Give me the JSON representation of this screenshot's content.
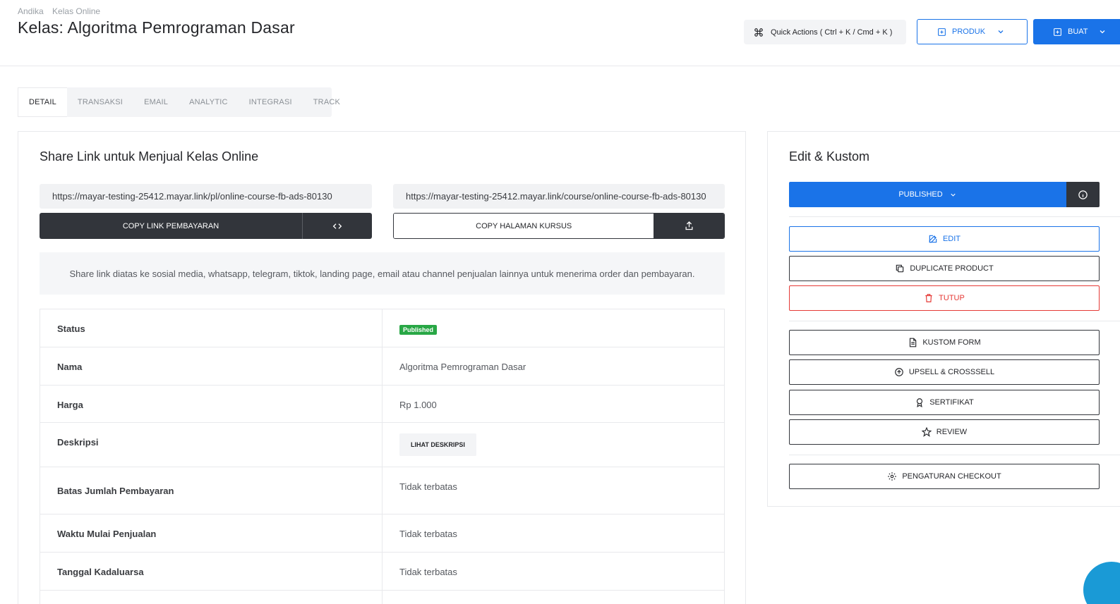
{
  "breadcrumb": [
    "Andika",
    "Kelas Online"
  ],
  "page_title": "Kelas: Algoritma Pemrograman Dasar",
  "header": {
    "quick_actions": "Quick Actions ( Ctrl + K / Cmd + K )",
    "produk_label": "PRODUK",
    "buat_label": "BUAT"
  },
  "tabs": [
    "DETAIL",
    "TRANSAKSI",
    "EMAIL",
    "ANALYTIC",
    "INTEGRASI",
    "TRACK"
  ],
  "share": {
    "title": "Share Link untuk Menjual Kelas Online",
    "payment_url": "https://mayar-testing-25412.mayar.link/pl/online-course-fb-ads-80130",
    "course_url": "https://mayar-testing-25412.mayar.link/course/online-course-fb-ads-80130",
    "copy_payment_label": "COPY LINK PEMBAYARAN",
    "copy_course_label": "COPY HALAMAN KURSUS",
    "info": "Share link diatas ke sosial media, whatsapp, telegram, tiktok, landing page, email atau channel penjualan lainnya untuk menerima order dan pembayaran."
  },
  "details": {
    "status_label": "Status",
    "status_value": "Published",
    "nama_label": "Nama",
    "nama_value": "Algoritma Pemrograman Dasar",
    "harga_label": "Harga",
    "harga_value": "Rp 1.000",
    "deskripsi_label": "Deskripsi",
    "deskripsi_button": "LIHAT DESKRIPSI",
    "batas_label": "Batas Jumlah Pembayaran",
    "batas_value": "Tidak terbatas",
    "mulai_label": "Waktu Mulai Penjualan",
    "mulai_value": "Tidak terbatas",
    "kadaluarsa_label": "Tanggal Kadaluarsa",
    "kadaluarsa_value": "Tidak terbatas"
  },
  "edit_panel": {
    "title": "Edit & Kustom",
    "published_label": "PUBLISHED",
    "edit": "EDIT",
    "duplicate": "DUPLICATE PRODUCT",
    "tutup": "TUTUP",
    "kustom_form": "KUSTOM FORM",
    "upsell": "UPSELL & CROSSSELL",
    "sertifikat": "SERTIFIKAT",
    "review": "REVIEW",
    "pengaturan_checkout": "PENGATURAN CHECKOUT"
  },
  "colors": {
    "primary": "#1a73e8",
    "dark": "#32353b",
    "success": "#28a745",
    "danger": "#e53935"
  }
}
